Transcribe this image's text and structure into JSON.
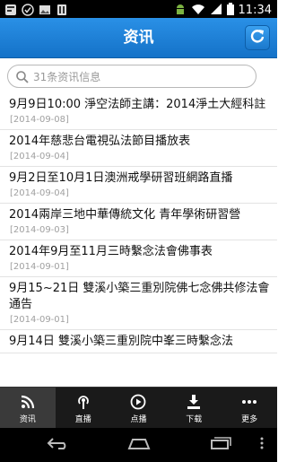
{
  "status_bar": {
    "time": "11:34",
    "icons": [
      "notification-icon",
      "check-circle-icon",
      "gallery-icon",
      "android-icon",
      "wifi-icon",
      "signal-icon",
      "battery-icon"
    ]
  },
  "header": {
    "title": "资讯",
    "refresh_icon": "refresh-icon"
  },
  "search": {
    "value": "",
    "placeholder": "31条资讯信息"
  },
  "news": [
    {
      "title": "9月9日10:00 淨空法師主講：2014淨土大經科註",
      "date": "[2014-09-08]"
    },
    {
      "title": "2014年慈悲台電視弘法節目播放表",
      "date": "[2014-09-04]"
    },
    {
      "title": "9月2日至10月1日澳洲戒學研習班網路直播",
      "date": "[2014-09-04]"
    },
    {
      "title": "2014兩岸三地中華傳統文化 青年學術研習營",
      "date": "[2014-09-03]"
    },
    {
      "title": "2014年9月至11月三時繫念法會佛事表",
      "date": "[2014-09-01]"
    },
    {
      "title": "9月15~21日 雙溪小築三重別院佛七念佛共修法會通告",
      "date": "[2014-09-01]"
    },
    {
      "title": "9月14日 雙溪小築三重別院中峯三時繫念法",
      "date": ""
    }
  ],
  "tabs": [
    {
      "label": "资讯",
      "icon": "rss-icon",
      "active": true
    },
    {
      "label": "直播",
      "icon": "broadcast-icon",
      "active": false
    },
    {
      "label": "点播",
      "icon": "play-icon",
      "active": false
    },
    {
      "label": "下载",
      "icon": "download-icon",
      "active": false
    },
    {
      "label": "更多",
      "icon": "more-icon",
      "active": false
    }
  ],
  "colors": {
    "header": "#1a7fd8",
    "tabbar": "#1a1a1a",
    "date_text": "#a0a0a0"
  }
}
